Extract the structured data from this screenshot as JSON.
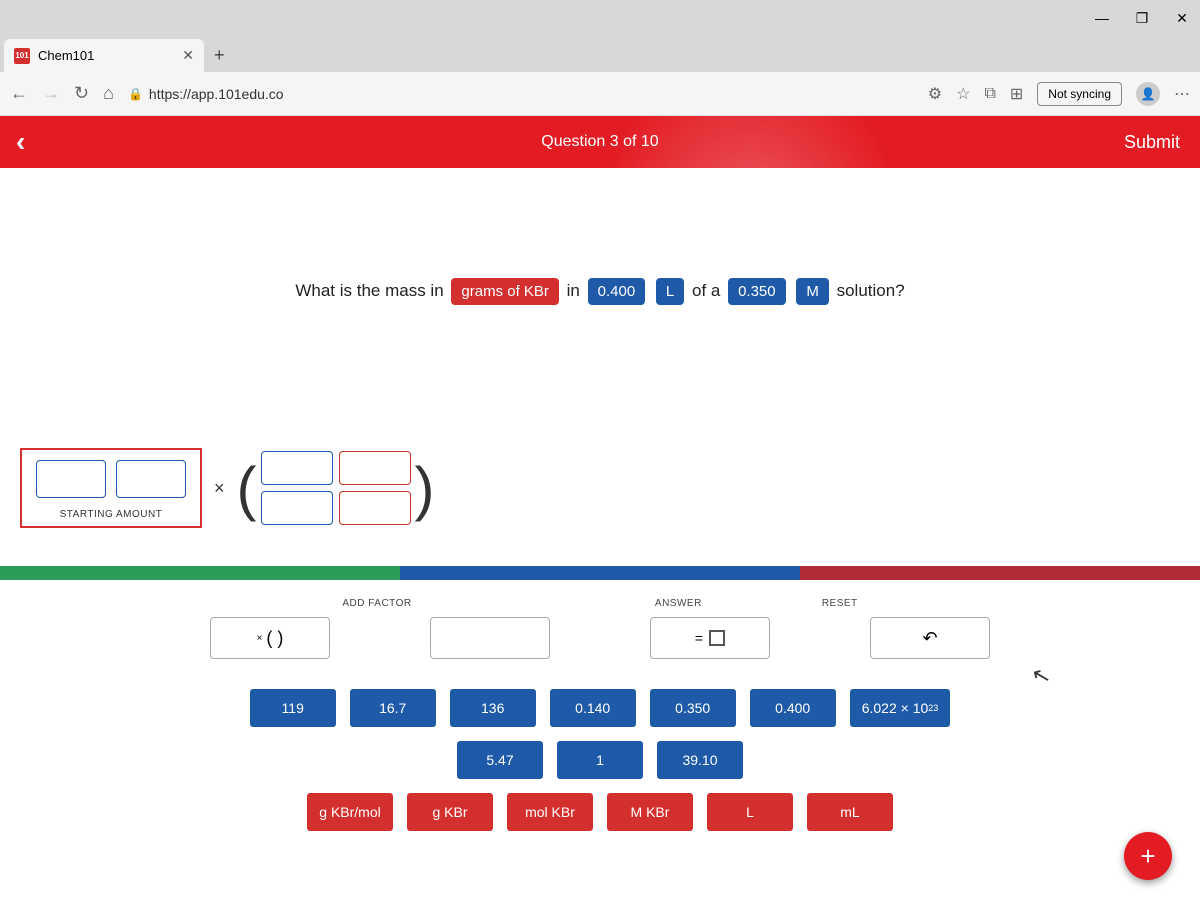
{
  "window": {
    "minimize": "—",
    "maximize": "❐",
    "close": "✕"
  },
  "tab": {
    "favicon": "101",
    "title": "Chem101",
    "close": "✕",
    "newtab": "+"
  },
  "addr": {
    "back": "←",
    "forward": "→",
    "refresh": "↻",
    "home": "⌂",
    "lock": "🔒",
    "url": "https://app.101edu.co",
    "ext": "⚙",
    "star": "☆",
    "fav": "⧉",
    "collections": "⊞",
    "not_syncing": "Not syncing",
    "avatar": "👤",
    "more": "⋯"
  },
  "header": {
    "back": "‹",
    "title": "Question 3 of 10",
    "submit": "Submit"
  },
  "question": {
    "p1": "What is the mass in",
    "chip1": "grams of KBr",
    "p2": "in",
    "chip2": "0.400",
    "chip3": "L",
    "p3": "of a",
    "chip4": "0.350",
    "chip5": "M",
    "p4": "solution?"
  },
  "eq": {
    "starting": "STARTING AMOUNT",
    "times": "×"
  },
  "controls": {
    "add_factor": "ADD FACTOR",
    "answer": "ANSWER",
    "reset": "RESET",
    "add_factor_sym": "( )",
    "reset_sym": "↶",
    "eq": "="
  },
  "tiles_num_1": [
    "119",
    "16.7",
    "136",
    "0.140",
    "0.350",
    "0.400"
  ],
  "tile_avogadro": "6.022 × 10",
  "tile_avogadro_sup": "23",
  "tiles_num_2": [
    "5.47",
    "1",
    "39.10"
  ],
  "tiles_unit": [
    "g KBr/mol",
    "g KBr",
    "mol KBr",
    "M KBr",
    "L",
    "mL"
  ],
  "fab": "+"
}
